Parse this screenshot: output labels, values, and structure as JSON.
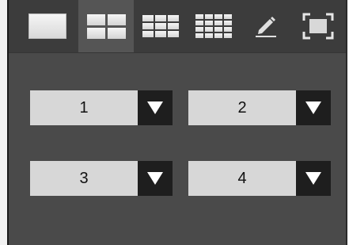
{
  "toolbar": {
    "icons": [
      "single-view-icon",
      "quad-view-icon",
      "nine-view-icon",
      "sixteen-view-icon",
      "pencil-icon",
      "fullscreen-icon"
    ],
    "active_index": 1
  },
  "channels": [
    {
      "value": "1"
    },
    {
      "value": "2"
    },
    {
      "value": "3"
    },
    {
      "value": "4"
    }
  ],
  "colors": {
    "panel": "#4a4a4a",
    "toolbar": "#3c3c3c",
    "select_bg": "#d7d7d7",
    "select_button": "#1e1e1e"
  }
}
